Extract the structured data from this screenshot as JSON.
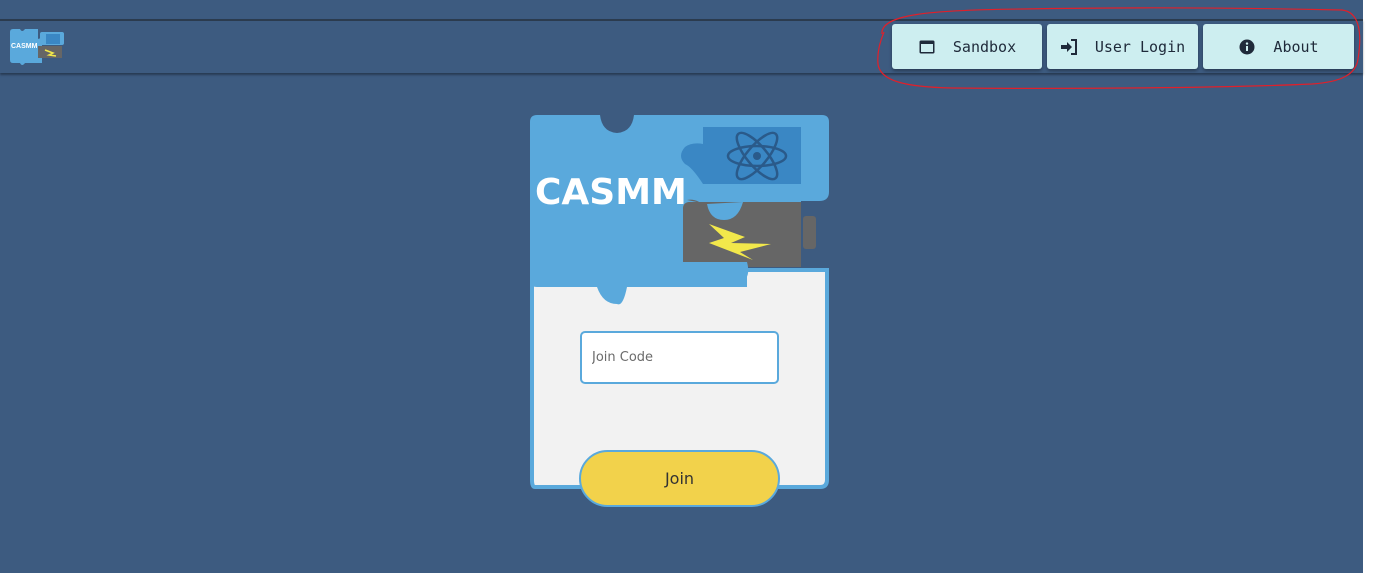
{
  "app": {
    "logo_text": "CASMM"
  },
  "nav": {
    "buttons": [
      {
        "label": "Sandbox",
        "icon": "window-icon"
      },
      {
        "label": "User Login",
        "icon": "sign-in-icon"
      },
      {
        "label": "About",
        "icon": "info-circle-icon"
      }
    ]
  },
  "card": {
    "title": "CASMM",
    "join_placeholder": "Join Code",
    "join_value": "",
    "join_button_label": "Join"
  },
  "colors": {
    "page_background": "#3d5b80",
    "nav_button": "#cdeef0",
    "puzzle_blue": "#5aa9dc",
    "card_body": "#f2f2f2",
    "join_button": "#f2d24b",
    "annotation": "#e0202a"
  }
}
